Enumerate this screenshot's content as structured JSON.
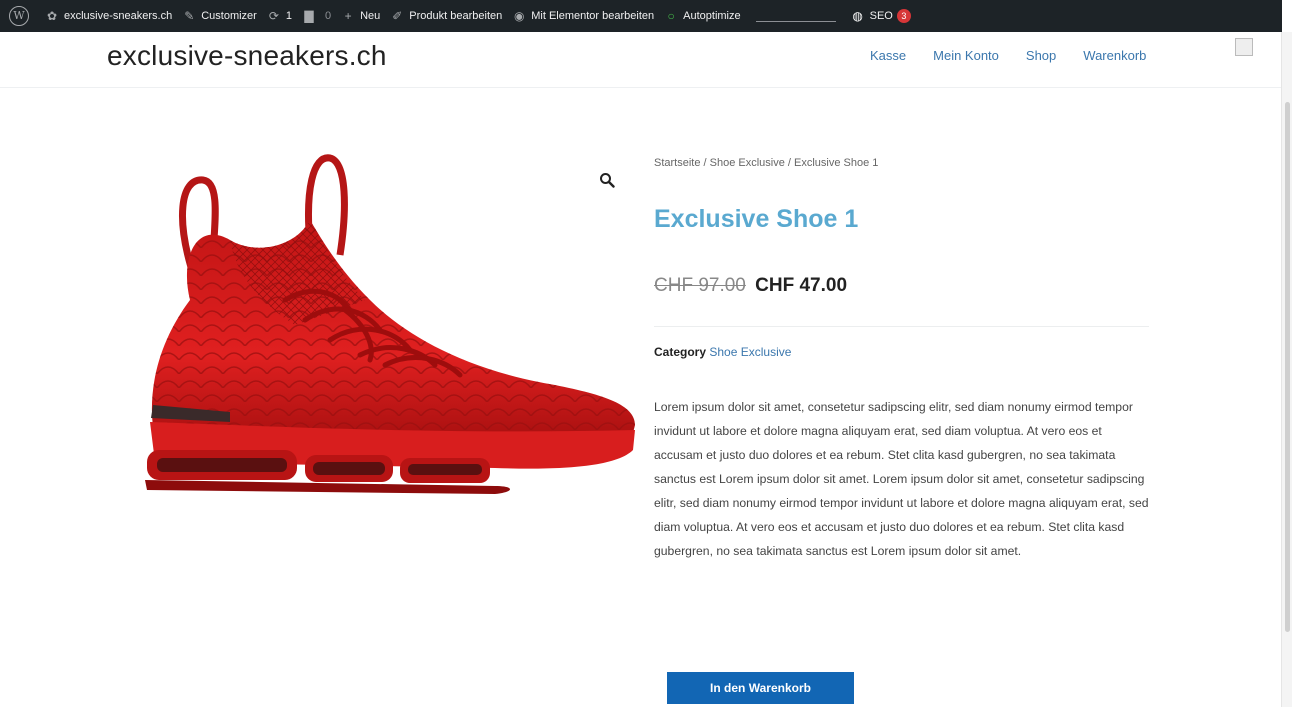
{
  "admin_bar": {
    "site_name": "exclusive-sneakers.ch",
    "customizer": "Customizer",
    "updates_count": "1",
    "comments_count": "0",
    "new_label": "Neu",
    "edit_product": "Produkt bearbeiten",
    "elementor": "Mit Elementor bearbeiten",
    "autoptimize": "Autoptimize",
    "seo_label": "SEO",
    "seo_badge": "3"
  },
  "header": {
    "site_title": "exclusive-sneakers.ch",
    "nav": [
      "Kasse",
      "Mein Konto",
      "Shop",
      "Warenkorb"
    ]
  },
  "product": {
    "breadcrumb": "Startseite / Shoe Exclusive / Exclusive Shoe 1",
    "title": "Exclusive Shoe 1",
    "old_price": "CHF 97.00",
    "price": "CHF 47.00",
    "category_label": "Category",
    "category_value": "Shoe Exclusive",
    "description": "Lorem ipsum dolor sit amet, consetetur sadipscing elitr, sed diam nonumy eirmod tempor invidunt ut labore et dolore magna aliquyam erat, sed diam voluptua. At vero eos et accusam et justo duo dolores et ea rebum. Stet clita kasd gubergren, no sea takimata sanctus est Lorem ipsum dolor sit amet. Lorem ipsum dolor sit amet, consetetur sadipscing elitr, sed diam nonumy eirmod tempor invidunt ut labore et dolore magna aliquyam erat, sed diam voluptua. At vero eos et accusam et justo duo dolores et ea rebum. Stet clita kasd gubergren, no sea takimata sanctus est Lorem ipsum dolor sit amet.",
    "add_to_cart": "In den Warenkorb",
    "shoe_color": "#d81e1e"
  },
  "icons": [
    "wordpress-icon",
    "dashboard-icon",
    "brush-icon",
    "updates-icon",
    "comment-icon",
    "plus-icon",
    "pencil-icon",
    "elementor-icon",
    "status-dot-icon",
    "seo-icon",
    "zoom-icon",
    "user-avatar-icon"
  ]
}
